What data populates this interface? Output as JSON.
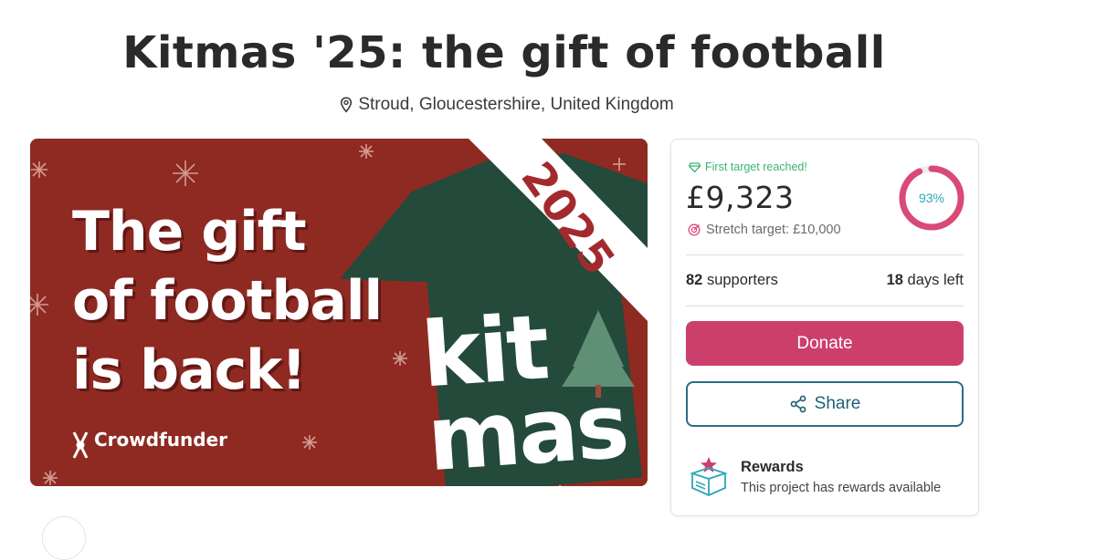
{
  "page": {
    "title": "Kitmas '25: the gift of football",
    "location": "Stroud, Gloucestershire, United Kingdom",
    "location_icon": "map-pin-icon"
  },
  "hero": {
    "headline_lines": [
      "The gift",
      "of football",
      "is back!"
    ],
    "year": "2025",
    "kit_lines": [
      "kit",
      "mas"
    ],
    "brand": "Crowdfunder",
    "colors": {
      "background": "#8e2a22",
      "shirt": "#234a3a",
      "tree": "#5f8f74",
      "sash": "#ffffff"
    }
  },
  "funding": {
    "target_badge": "First target reached!",
    "amount": "£9,323",
    "stretch_target": "Stretch target: £10,000",
    "percent": 93,
    "percent_label": "93%",
    "supporters_count": "82",
    "supporters_label": "supporters",
    "days_count": "18",
    "days_label": "days left",
    "colors": {
      "ring": "#d94a76",
      "ring_track": "#ececec",
      "success": "#3cb371"
    }
  },
  "actions": {
    "donate_label": "Donate",
    "share_label": "Share",
    "share_icon": "share-icon",
    "donate_color": "#cc3f6c",
    "share_color": "#2c6c83"
  },
  "rewards": {
    "title": "Rewards",
    "subtitle": "This project has rewards available",
    "icon": "gift-box-icon"
  }
}
